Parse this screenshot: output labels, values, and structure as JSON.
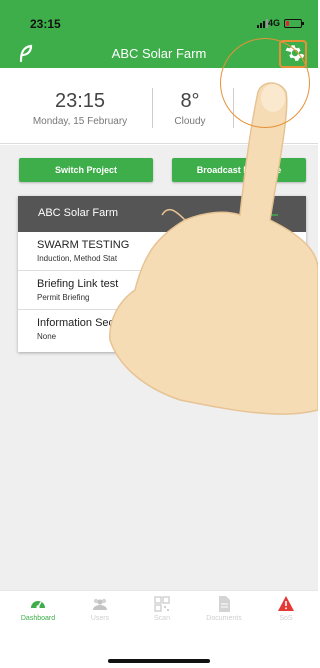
{
  "status_bar": {
    "time": "23:15",
    "network": "4G"
  },
  "app_bar": {
    "title": "ABC Solar Farm"
  },
  "info": {
    "time": "23:15",
    "date": "Monday, 15 February",
    "temperature": "8°",
    "condition": "Cloudy"
  },
  "actions": {
    "switch_project": "Switch Project",
    "broadcast": "Broadcast Message"
  },
  "project_card": {
    "name": "ABC Solar Farm",
    "items": [
      {
        "title": "SWARM TESTING",
        "subtitle": "Induction, Method Stat"
      },
      {
        "title": "Briefing Link test",
        "subtitle": "Permit Briefing"
      },
      {
        "title": "Information Secu",
        "subtitle": "None"
      }
    ]
  },
  "tabs": [
    {
      "label": "Dashboard",
      "icon": "dashboard-gauge-icon"
    },
    {
      "label": "Users",
      "icon": "users-icon"
    },
    {
      "label": "Scan",
      "icon": "qr-scan-icon"
    },
    {
      "label": "Documents",
      "icon": "document-icon"
    },
    {
      "label": "SoS",
      "icon": "warning-icon"
    }
  ],
  "colors": {
    "brand": "#3dae49",
    "card_header": "#555555",
    "highlight": "#e69138",
    "sos": "#e53935"
  }
}
